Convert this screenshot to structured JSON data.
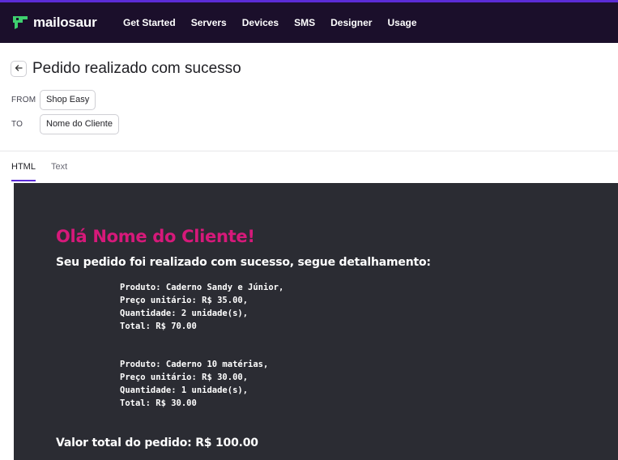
{
  "topbar": {
    "brand": "mailosaur",
    "nav": [
      "Get Started",
      "Servers",
      "Devices",
      "SMS",
      "Designer",
      "Usage"
    ],
    "accent_color": "#5b2cd6",
    "logo_color": "#3ecf6e"
  },
  "message": {
    "subject": "Pedido realizado com sucesso",
    "from_label": "FROM",
    "from_value": "Shop Easy",
    "to_label": "TO",
    "to_value": "Nome do Cliente"
  },
  "tabs": [
    {
      "label": "HTML",
      "active": true
    },
    {
      "label": "Text",
      "active": false
    }
  ],
  "email": {
    "greeting": "Olá Nome do Cliente!",
    "intro": "Seu pedido foi realizado com sucesso, segue detalhamento:",
    "items": [
      {
        "product": "Produto: Caderno Sandy e Júnior,",
        "unit_price": "Preço unitário: R$ 35.00,",
        "quantity": "Quantidade: 2 unidade(s),",
        "total": "Total: R$ 70.00"
      },
      {
        "product": "Produto: Caderno 10 matérias,",
        "unit_price": "Preço unitário: R$ 30.00,",
        "quantity": "Quantidade: 1 unidade(s),",
        "total": "Total: R$ 30.00"
      }
    ],
    "grand_total": "Valor total do pedido: R$ 100.00",
    "greeting_color": "#d6197a",
    "background_color": "#2b2c33"
  }
}
